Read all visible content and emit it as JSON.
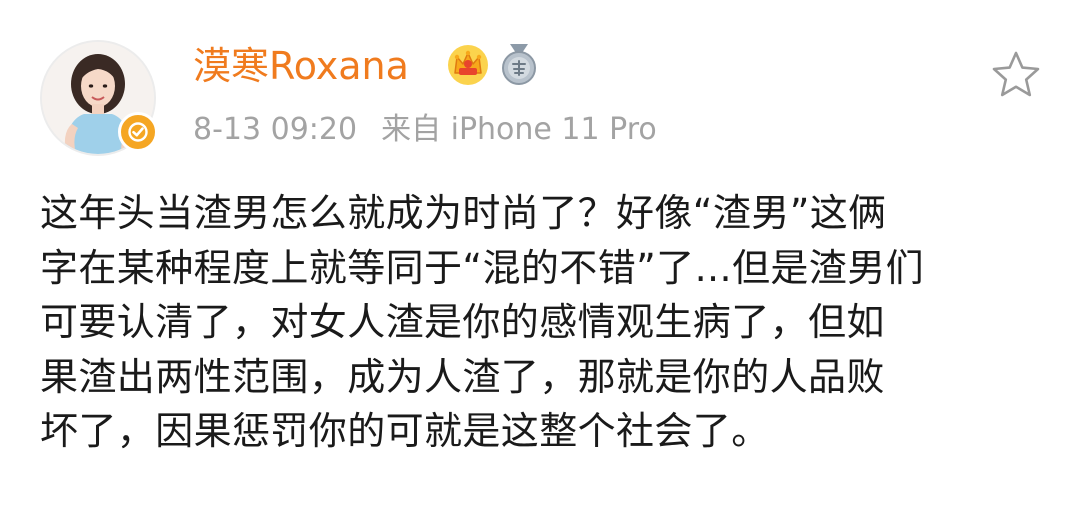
{
  "post": {
    "username": "漠寒Roxana",
    "time": "8-13 09:20",
    "source": "来自 iPhone 11 Pro",
    "lines": [
      "这年头当渣男怎么就成为时尚了？好像“渣男”这俩",
      "字在某种程度上就等同于“混的不错”了...但是渣男们",
      "可要认清了，对女人渣是你的感情观生病了，但如",
      "果渣出两性范围，成为人渣了，那就是你的人品败",
      "坏了，因果惩罚你的可就是这整个社会了。"
    ]
  },
  "icons": {
    "avatar": "avatar-photo",
    "verified": "verified-check-icon",
    "vip": "crown-vip-icon",
    "medal": "medal-icon",
    "favorite": "star-icon"
  },
  "colors": {
    "username": "#f07b1e",
    "meta": "#a3a3a3",
    "text": "#1a1a1a",
    "verified_badge": "#f5a623",
    "star_outline": "#9a9a9a"
  }
}
